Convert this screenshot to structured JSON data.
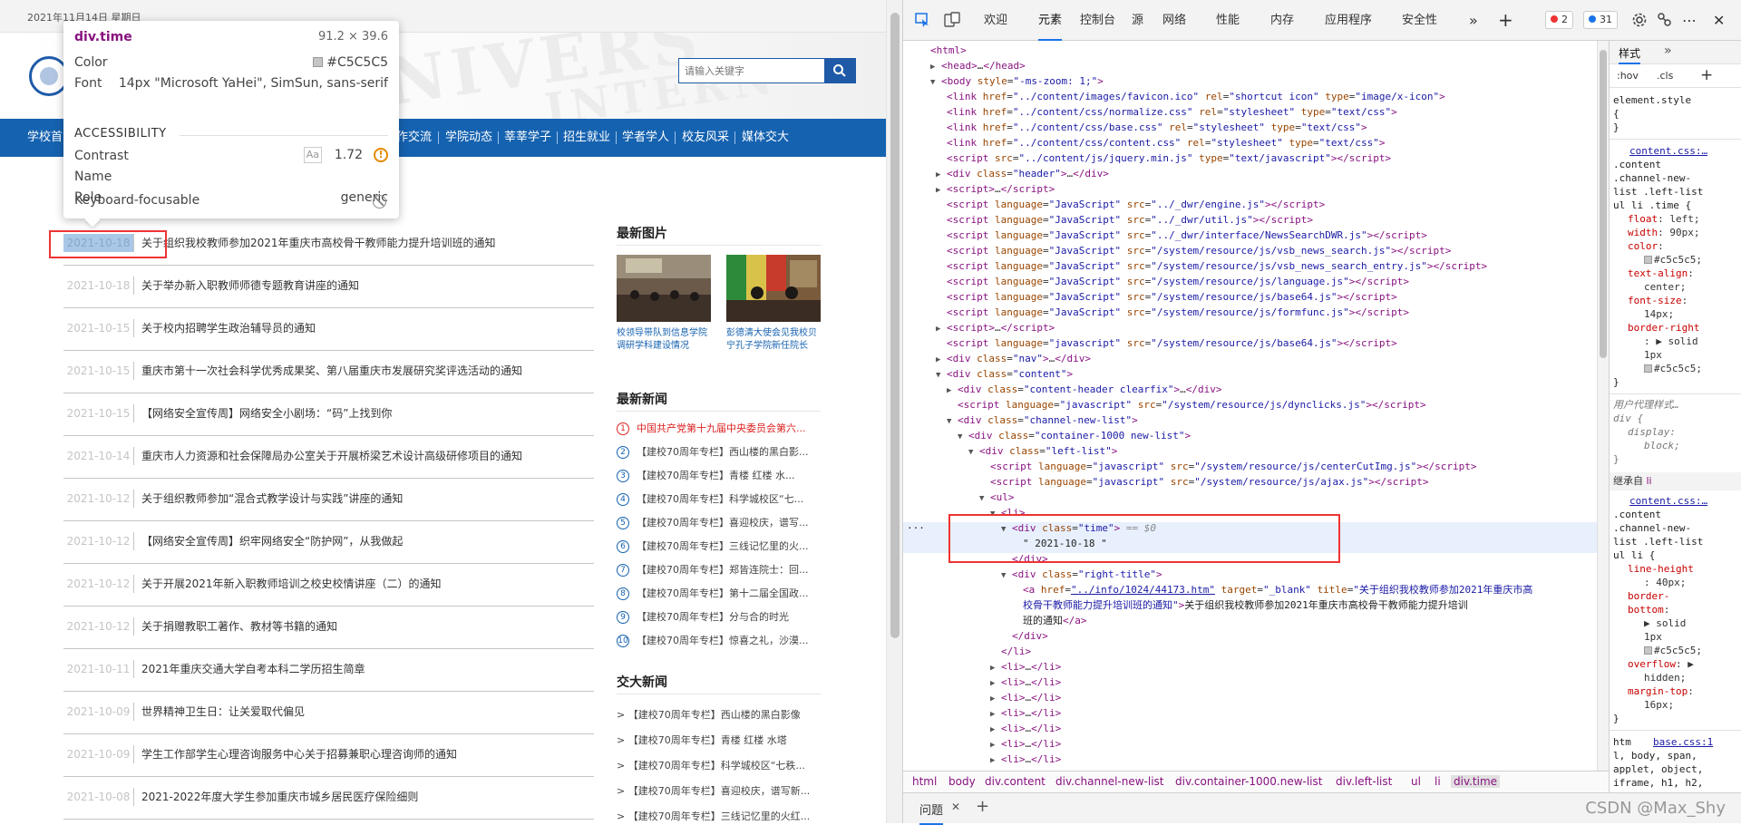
{
  "page": {
    "date": "2021年11月14日 星期日",
    "search_placeholder": "请输入关键字",
    "nav": [
      "学校首",
      "作交流",
      "学院动态",
      "莘莘学子",
      "招生就业",
      "学者学人",
      "校友风采",
      "媒体交大"
    ],
    "list": [
      {
        "time": "2021-10-18",
        "title": "关于组织我校教师参加2021年重庆市高校骨干教师能力提升培训班的通知"
      },
      {
        "time": "2021-10-18",
        "title": "关于举办新入职教师师德专题教育讲座的通知"
      },
      {
        "time": "2021-10-15",
        "title": "关于校内招聘学生政治辅导员的通知"
      },
      {
        "time": "2021-10-15",
        "title": "重庆市第十一次社会科学优秀成果奖、第八届重庆市发展研究奖评选活动的通知"
      },
      {
        "time": "2021-10-15",
        "title": "【网络安全宣传周】网络安全小剧场：“码”上找到你"
      },
      {
        "time": "2021-10-14",
        "title": "重庆市人力资源和社会保障局办公室关于开展桥梁艺术设计高级研修项目的通知"
      },
      {
        "time": "2021-10-12",
        "title": "关于组织教师参加“混合式教学设计与实践”讲座的通知"
      },
      {
        "time": "2021-10-12",
        "title": "【网络安全宣传周】织牢网络安全“防护网”，从我做起"
      },
      {
        "time": "2021-10-12",
        "title": "关于开展2021年新入职教师培训之校史校情讲座（二）的通知"
      },
      {
        "time": "2021-10-12",
        "title": "关于捐赠教职工著作、教材等书籍的通知"
      },
      {
        "time": "2021-10-11",
        "title": "2021年重庆交通大学自考本科二学历招生简章"
      },
      {
        "time": "2021-10-09",
        "title": "世界精神卫生日：让关爱取代偏见"
      },
      {
        "time": "2021-10-09",
        "title": "学生工作部学生心理咨询服务中心关于招募兼职心理咨询师的通知"
      },
      {
        "time": "2021-10-08",
        "title": "2021-2022年度大学生参加重庆市城乡居民医疗保险细则"
      }
    ],
    "side": {
      "pics_title": "最新图片",
      "pics": [
        {
          "caption": "校领导带队到信息学院调研学科建设情况"
        },
        {
          "caption": "彭德清大使会见我校贝宁孔子学院新任院长"
        }
      ],
      "news_title": "最新新闻",
      "news": [
        {
          "num": "1",
          "text": "中国共产党第十九届中央委员会第六..."
        },
        {
          "num": "2",
          "text": "【建校70周年专栏】西山楼的黑白影..."
        },
        {
          "num": "3",
          "text": "【建校70周年专栏】青楼 红楼 水..."
        },
        {
          "num": "4",
          "text": "【建校70周年专栏】科学城校区“七..."
        },
        {
          "num": "5",
          "text": "【建校70周年专栏】喜迎校庆，谱写..."
        },
        {
          "num": "6",
          "text": "【建校70周年专栏】三线记忆里的火..."
        },
        {
          "num": "7",
          "text": "【建校70周年专栏】郑皆连院士：回..."
        },
        {
          "num": "8",
          "text": "【建校70周年专栏】第十二届全国政..."
        },
        {
          "num": "9",
          "text": "【建校70周年专栏】分与合的时光"
        },
        {
          "num": "10",
          "text": "【建校70周年专栏】惊喜之礼，沙漠..."
        }
      ],
      "jd_title": "交大新闻",
      "jd_news": [
        "> 【建校70周年专栏】西山楼的黑白影像",
        "> 【建校70周年专栏】青楼 红楼 水塔",
        "> 【建校70周年专栏】科学城校区“七秩...",
        "> 【建校70周年专栏】喜迎校庆，谱写新...",
        "> 【建校70周年专栏】三线记忆里的火红..."
      ]
    }
  },
  "tooltip": {
    "name": "div.time",
    "size": "91.2 × 39.6",
    "color_label": "Color",
    "color_value": "#C5C5C5",
    "font_label": "Font",
    "font_value": "14px \"Microsoft YaHei\", SimSun, sans-serif",
    "accessibility": "ACCESSIBILITY",
    "contrast_label": "Contrast",
    "contrast_aa": "Aa",
    "contrast_value": "1.72",
    "name_label": "Name",
    "role_label": "Role",
    "role_value": "generic",
    "keyboard_label": "Keyboard-focusable"
  },
  "devtools": {
    "tabs": [
      "欢迎",
      "元素",
      "控制台",
      "源",
      "网络",
      "性能",
      "内存",
      "应用程序",
      "安全性"
    ],
    "active_tab": "元素",
    "errors": "2",
    "messages": "31",
    "styles_tab": "样式",
    "hov": ":hov",
    "cls": ".cls",
    "crumbs": [
      "html",
      "body",
      "div.content",
      "div.channel-new-list",
      "div.container-1000.new-list",
      "div.left-list",
      "ul",
      "li",
      "div.time"
    ],
    "drawer_tab": "问题",
    "watermark": "CSDN @Max_Shy"
  },
  "colors": {
    "nav": "#1562b0",
    "accent": "#1a73e8",
    "time_text": "#c5c5c5",
    "highlight": "#e33333"
  }
}
